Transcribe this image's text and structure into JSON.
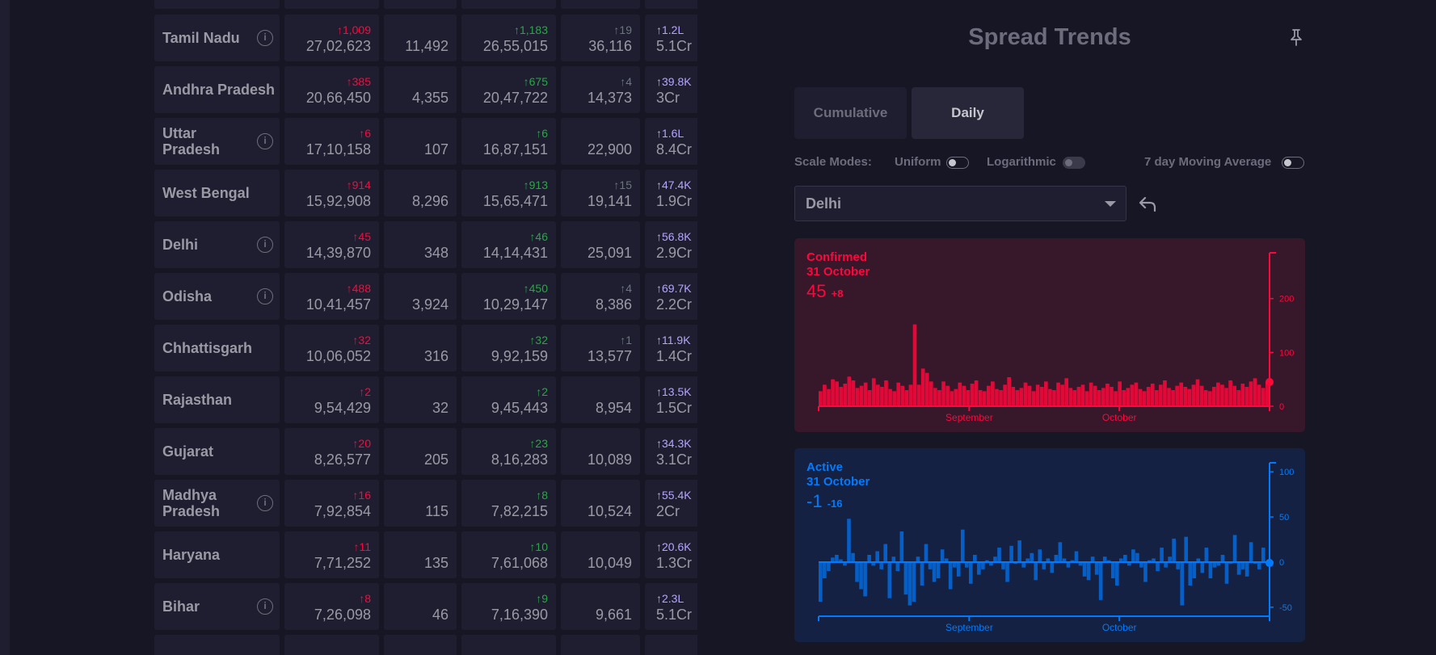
{
  "colors": {
    "confirmed": "#ff073a",
    "recovered": "#28a745",
    "deceased": "#6c757d",
    "tested": "#b6a5ff",
    "active": "#007bff"
  },
  "table": {
    "rows": [
      {
        "state": "Tamil Nadu",
        "info": true,
        "confirmed_delta": "↑1,009",
        "confirmed": "27,02,623",
        "active": "11,492",
        "recovered_delta": "↑1,183",
        "recovered": "26,55,015",
        "deceased_delta": "↑19",
        "deceased": "36,116",
        "tested_delta": "↑1.2L",
        "tested": "5.1Cr"
      },
      {
        "state": "Andhra Pradesh",
        "info": false,
        "confirmed_delta": "↑385",
        "confirmed": "20,66,450",
        "active": "4,355",
        "recovered_delta": "↑675",
        "recovered": "20,47,722",
        "deceased_delta": "↑4",
        "deceased": "14,373",
        "tested_delta": "↑39.8K",
        "tested": "3Cr"
      },
      {
        "state": "Uttar Pradesh",
        "info": true,
        "confirmed_delta": "↑6",
        "confirmed": "17,10,158",
        "active": "107",
        "recovered_delta": "↑6",
        "recovered": "16,87,151",
        "deceased_delta": "",
        "deceased": "22,900",
        "tested_delta": "↑1.6L",
        "tested": "8.4Cr"
      },
      {
        "state": "West Bengal",
        "info": false,
        "confirmed_delta": "↑914",
        "confirmed": "15,92,908",
        "active": "8,296",
        "recovered_delta": "↑913",
        "recovered": "15,65,471",
        "deceased_delta": "↑15",
        "deceased": "19,141",
        "tested_delta": "↑47.4K",
        "tested": "1.9Cr"
      },
      {
        "state": "Delhi",
        "info": true,
        "confirmed_delta": "↑45",
        "confirmed": "14,39,870",
        "active": "348",
        "recovered_delta": "↑46",
        "recovered": "14,14,431",
        "deceased_delta": "",
        "deceased": "25,091",
        "tested_delta": "↑56.8K",
        "tested": "2.9Cr"
      },
      {
        "state": "Odisha",
        "info": true,
        "confirmed_delta": "↑488",
        "confirmed": "10,41,457",
        "active": "3,924",
        "recovered_delta": "↑450",
        "recovered": "10,29,147",
        "deceased_delta": "↑4",
        "deceased": "8,386",
        "tested_delta": "↑69.7K",
        "tested": "2.2Cr"
      },
      {
        "state": "Chhattisgarh",
        "info": false,
        "confirmed_delta": "↑32",
        "confirmed": "10,06,052",
        "active": "316",
        "recovered_delta": "↑32",
        "recovered": "9,92,159",
        "deceased_delta": "↑1",
        "deceased": "13,577",
        "tested_delta": "↑11.9K",
        "tested": "1.4Cr"
      },
      {
        "state": "Rajasthan",
        "info": false,
        "confirmed_delta": "↑2",
        "confirmed": "9,54,429",
        "active": "32",
        "recovered_delta": "↑2",
        "recovered": "9,45,443",
        "deceased_delta": "",
        "deceased": "8,954",
        "tested_delta": "↑13.5K",
        "tested": "1.5Cr"
      },
      {
        "state": "Gujarat",
        "info": false,
        "confirmed_delta": "↑20",
        "confirmed": "8,26,577",
        "active": "205",
        "recovered_delta": "↑23",
        "recovered": "8,16,283",
        "deceased_delta": "",
        "deceased": "10,089",
        "tested_delta": "↑34.3K",
        "tested": "3.1Cr"
      },
      {
        "state": "Madhya Pradesh",
        "info": true,
        "confirmed_delta": "↑16",
        "confirmed": "7,92,854",
        "active": "115",
        "recovered_delta": "↑8",
        "recovered": "7,82,215",
        "deceased_delta": "",
        "deceased": "10,524",
        "tested_delta": "↑55.4K",
        "tested": "2Cr"
      },
      {
        "state": "Haryana",
        "info": false,
        "confirmed_delta": "↑11",
        "confirmed": "7,71,252",
        "active": "135",
        "recovered_delta": "↑10",
        "recovered": "7,61,068",
        "deceased_delta": "",
        "deceased": "10,049",
        "tested_delta": "↑20.6K",
        "tested": "1.3Cr"
      },
      {
        "state": "Bihar",
        "info": true,
        "confirmed_delta": "↑8",
        "confirmed": "7,26,098",
        "active": "46",
        "recovered_delta": "↑9",
        "recovered": "7,16,390",
        "deceased_delta": "",
        "deceased": "9,661",
        "tested_delta": "↑2.3L",
        "tested": "5.1Cr"
      }
    ]
  },
  "panel": {
    "title": "Spread Trends",
    "tabs": [
      "Cumulative",
      "Daily"
    ],
    "active_tab": "Daily",
    "scale_modes_label": "Scale Modes:",
    "uniform_label": "Uniform",
    "logarithmic_label": "Logarithmic",
    "moving_avg_label": "7 day Moving Average",
    "selected_region": "Delhi"
  },
  "chart_data": [
    {
      "type": "bar",
      "title": "Confirmed",
      "date": "31 October",
      "value": "45",
      "delta": "+8",
      "color": "#ff073a",
      "x_ticks": [
        "September",
        "October"
      ],
      "y_ticks": [
        0,
        100,
        200
      ],
      "ylim": [
        0,
        285
      ],
      "values": [
        28,
        40,
        32,
        50,
        46,
        36,
        42,
        55,
        48,
        34,
        38,
        44,
        30,
        52,
        40,
        36,
        48,
        32,
        28,
        44,
        38,
        30,
        40,
        152,
        40,
        70,
        62,
        46,
        34,
        30,
        46,
        38,
        28,
        32,
        44,
        38,
        30,
        42,
        48,
        30,
        28,
        38,
        46,
        32,
        30,
        40,
        54,
        36,
        30,
        34,
        44,
        38,
        28,
        40,
        36,
        46,
        32,
        30,
        44,
        40,
        52,
        34,
        30,
        36,
        40,
        28,
        44,
        38,
        30,
        34,
        42,
        36,
        28,
        46,
        30,
        34,
        40,
        44,
        32,
        28,
        36,
        42,
        30,
        40,
        48,
        34,
        30,
        38,
        44,
        36,
        32,
        40,
        50,
        38,
        30,
        28,
        36,
        44,
        40,
        34,
        48,
        38,
        30,
        42,
        36,
        46,
        52,
        40,
        34,
        45
      ],
      "tick_positions": [
        0,
        0.334,
        0.667,
        1
      ]
    },
    {
      "type": "bar",
      "title": "Active",
      "date": "31 October",
      "value": "-1",
      "delta": "-16",
      "color": "#007bff",
      "x_ticks": [
        "September",
        "October"
      ],
      "y_ticks": [
        -50,
        0,
        50,
        100
      ],
      "ylim": [
        -60,
        110
      ],
      "values": [
        -44,
        -18,
        -10,
        5,
        8,
        3,
        -4,
        48,
        10,
        -22,
        -30,
        -38,
        8,
        -4,
        12,
        -8,
        20,
        -40,
        6,
        -10,
        34,
        -36,
        -48,
        -44,
        6,
        -26,
        20,
        -8,
        -22,
        -18,
        14,
        4,
        -30,
        -6,
        -16,
        36,
        -6,
        -24,
        8,
        -14,
        -8,
        2,
        -4,
        6,
        16,
        -8,
        -22,
        18,
        -2,
        24,
        -6,
        4,
        10,
        -20,
        14,
        -8,
        4,
        -12,
        8,
        22,
        4,
        -6,
        2,
        12,
        -4,
        -16,
        -20,
        6,
        -14,
        -42,
        6,
        2,
        -18,
        -26,
        4,
        8,
        -4,
        14,
        10,
        -6,
        -22,
        2,
        4,
        -10,
        16,
        -6,
        6,
        26,
        -8,
        -48,
        28,
        -26,
        -18,
        4,
        -12,
        16,
        -18,
        -6,
        -4,
        8,
        -24,
        -2,
        30,
        -14,
        -8,
        -16,
        22,
        -2,
        -8,
        16,
        -1
      ],
      "tick_positions": [
        0,
        0.334,
        0.667,
        1
      ]
    }
  ]
}
